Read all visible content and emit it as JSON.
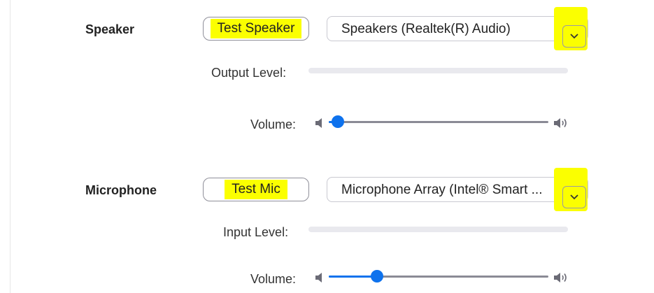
{
  "speaker": {
    "title": "Speaker",
    "test_button": "Test Speaker",
    "device_selected": "Speakers (Realtek(R) Audio)",
    "output_level_label": "Output Level:",
    "output_level_value": 0,
    "volume_label": "Volume:",
    "volume_value": 0.04
  },
  "microphone": {
    "title": "Microphone",
    "test_button": "Test Mic",
    "device_selected": "Microphone Array (Intel® Smart ...",
    "input_level_label": "Input Level:",
    "input_level_value": 0,
    "volume_label": "Volume:",
    "volume_value": 0.22
  },
  "colors": {
    "accent": "#0e72ed",
    "highlight": "#fbff00",
    "track": "#8a8a95",
    "level_bar": "#e9e9ee"
  },
  "icons": {
    "volume_low": "speaker-low-icon",
    "volume_high": "speaker-high-icon",
    "dropdown": "chevron-down-icon"
  }
}
